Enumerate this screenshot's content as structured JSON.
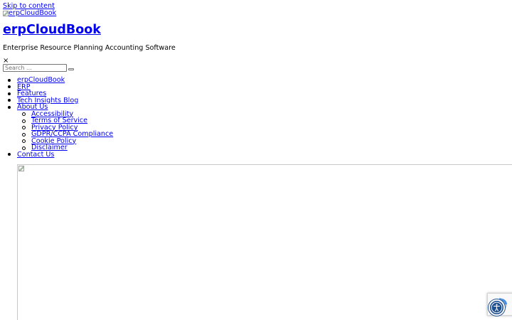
{
  "skip_link": "Skip to content",
  "logo_alt": "erpCloudBook",
  "site_title": "erpCloudBook",
  "site_description": "Enterprise Resource Planning Accounting Software",
  "close_glyph": "×",
  "search": {
    "placeholder": "Search ..."
  },
  "menu": {
    "items": [
      {
        "label": "erpCloudBook"
      },
      {
        "label": "ERP"
      },
      {
        "label": "Features"
      },
      {
        "label": "Tech Insights Blog"
      },
      {
        "label": "About Us"
      },
      {
        "label": "Contact Us"
      }
    ],
    "about_submenu": [
      {
        "label": "Accessibility"
      },
      {
        "label": "Terms of Service"
      },
      {
        "label": "Privacy Policy"
      },
      {
        "label": "GDPR/CCPA Compliance"
      },
      {
        "label": "Cookie Policy"
      },
      {
        "label": "Disclaimer"
      }
    ]
  },
  "icons": {
    "recaptcha": "recaptcha-icon",
    "accessibility": "accessibility-icon"
  },
  "colors": {
    "link": "#0000ee",
    "accessibility_button": "#1e4f8f",
    "recaptcha_blue": "#4a90e2"
  }
}
